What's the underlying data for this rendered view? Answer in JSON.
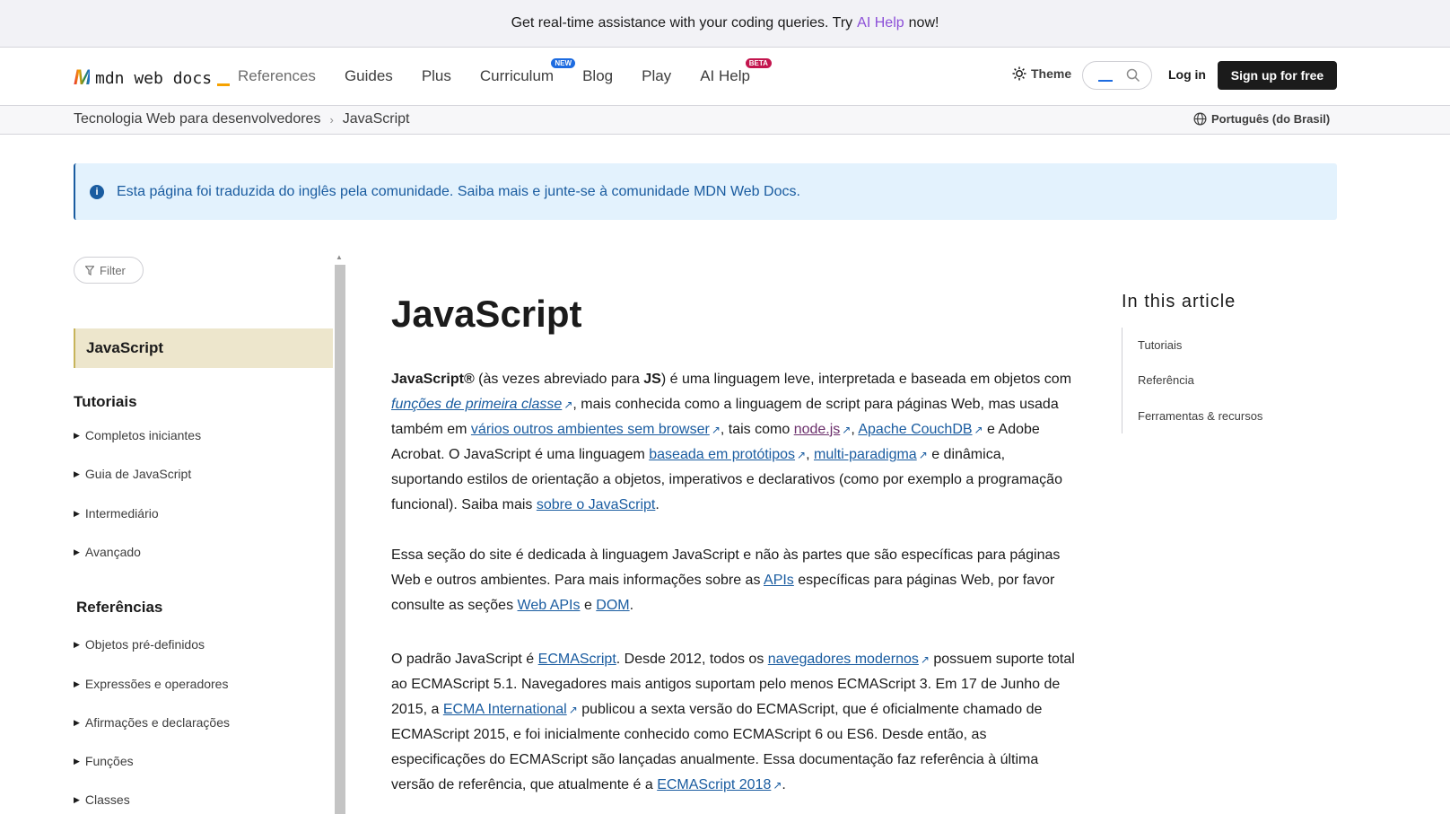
{
  "banner": {
    "prefix": "Get real-time assistance with your coding queries. Try",
    "link": "AI Help",
    "suffix": "now!"
  },
  "header": {
    "logo_text": "mdn web docs",
    "nav": [
      {
        "label": "References"
      },
      {
        "label": "Guides"
      },
      {
        "label": "Plus"
      },
      {
        "label": "Curriculum",
        "badge": "NEW"
      },
      {
        "label": "Blog"
      },
      {
        "label": "Play"
      },
      {
        "label": "AI Help",
        "badge": "BETA"
      }
    ],
    "theme_label": "Theme",
    "login_label": "Log in",
    "signup_label": "Sign up for free"
  },
  "breadcrumb": {
    "items": [
      "Tecnologia Web para desenvolvedores",
      "JavaScript"
    ],
    "separator": "›",
    "language": "Português (do Brasil)"
  },
  "notice": {
    "icon": "i",
    "text": "Esta página foi traduzida do inglês pela comunidade. Saiba mais e junte-se à comunidade MDN Web Docs."
  },
  "sidebar": {
    "filter_label": "Filter",
    "active": "JavaScript",
    "tutorials_heading": "Tutoriais",
    "tutorials": [
      "Completos iniciantes",
      "Guia de JavaScript",
      "Intermediário",
      "Avançado"
    ],
    "reference_heading": "Referências",
    "references": [
      "Objetos pré-definidos",
      "Expressões e operadores",
      "Afirmações e declarações",
      "Funções",
      "Classes"
    ]
  },
  "article": {
    "title": "JavaScript",
    "p1": {
      "s1": "JavaScript®",
      "s2": " (às vezes abreviado para ",
      "s3": "JS",
      "s4": ") é uma linguagem leve, interpretada e baseada em objetos com ",
      "l1": "funções de primeira classe",
      "s5": ", mais conhecida como a linguagem de script para páginas Web, mas usada também em ",
      "l2": "vários outros ambientes sem browser",
      "s6": ", tais como ",
      "l3": "node.js",
      "s7": ", ",
      "l4": "Apache CouchDB",
      "s8": " e Adobe Acrobat. O JavaScript é uma linguagem ",
      "l5": "baseada em protótipos",
      "s9": ", ",
      "l6": "multi-paradigma",
      "s10": " e dinâmica, suportando estilos de orientação a objetos, imperativos e declarativos (como por exemplo a programação funcional). Saiba mais ",
      "l7": "sobre o JavaScript",
      "s11": "."
    },
    "p2": {
      "s1": "Essa seção do site é dedicada à linguagem JavaScript e não às partes que são específicas para páginas Web e outros ambientes. Para mais informações sobre as ",
      "l1": "APIs",
      "s2": " específicas para páginas Web, por favor consulte as seções ",
      "l2": "Web APIs",
      "s3": " e ",
      "l3": "DOM",
      "s4": "."
    },
    "p3": {
      "s1": "O padrão JavaScript é ",
      "l1": "ECMAScript",
      "s2": ". Desde 2012, todos os ",
      "l2": "navegadores modernos",
      "s3": " possuem suporte total ao ECMAScript 5.1. Navegadores mais antigos suportam pelo menos ECMAScript 3. Em 17 de Junho de 2015, a ",
      "l3": "ECMA International",
      "s4": " publicou a sexta versão do ECMAScript, que é oficialmente chamado de ECMAScript 2015, e foi inicialmente conhecido como ECMAScript 6 ou ES6. Desde então, as especificações do ECMAScript são lançadas anualmente. Essa documentação faz referência à última versão de referência, que atualmente é a ",
      "l4": "ECMAScript 2018",
      "s5": "."
    }
  },
  "toc": {
    "title": "In this article",
    "items": [
      "Tutoriais",
      "Referência",
      "Ferramentas & recursos"
    ]
  },
  "colors": {
    "accent": "#1a5ca0",
    "ai": "#8c4fd8",
    "active_bg": "#ede6cc",
    "notice_bg": "#e3f2fd"
  },
  "icons": {
    "theme": "sun-icon",
    "search": "search-icon",
    "language": "globe-icon",
    "filter": "filter-icon",
    "external": "external-link-icon"
  }
}
